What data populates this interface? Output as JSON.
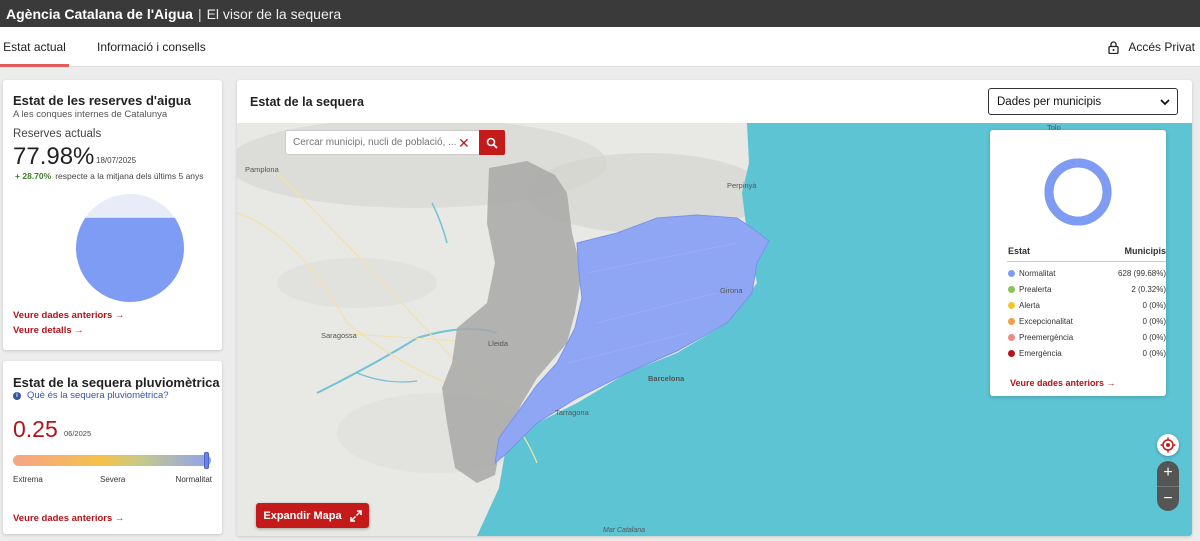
{
  "header": {
    "brand": "Agència Catalana de l'Aigua",
    "separator": "|",
    "subtitle": "El visor de la sequera"
  },
  "nav": {
    "tabs": [
      {
        "label": "Estat actual",
        "active": true
      },
      {
        "label": "Informació i consells",
        "active": false
      }
    ],
    "private_access": "Accés Privat"
  },
  "reserves": {
    "title": "Estat de les reserves d'aigua",
    "subtitle": "A les conques internes de Catalunya",
    "label": "Reserves actuals",
    "value": "77.98%",
    "fill_fraction": 0.7798,
    "date": "18/07/2025",
    "delta_prefix": "+",
    "delta": "28.70%",
    "delta_text": "respecte a la mitjana dels últims 5 anys",
    "link_previous": "Veure dades anteriors",
    "link_details": "Veure detalls"
  },
  "pluviometric": {
    "title": "Estat de la sequera pluviomètrica",
    "info_link": "Què és la sequera pluviomètrica?",
    "value": "0.25",
    "date": "06/2025",
    "scale_labels": [
      "Extrema",
      "Severa",
      "Normalitat"
    ],
    "marker_fraction": 0.985,
    "link_previous": "Veure dades anteriors"
  },
  "map": {
    "title": "Estat de la sequera",
    "select_value": "Dades per municipis",
    "search_placeholder": "Cercar municipi, nucli de població, ...",
    "expand_label": "Expandir Mapa",
    "place_labels": {
      "pamplona": "Pamplona",
      "perpinya": "Perpinyà",
      "saragossa": "Saragossa",
      "lleida": "Lleida",
      "girona": "Girona",
      "barcelona": "Barcelona",
      "tarragona": "Tarragona",
      "mar": "Mar Catalana",
      "tolo": "Tolo"
    },
    "zoom_in": "+",
    "zoom_out": "−"
  },
  "legend": {
    "col_state": "Estat",
    "col_count": "Municipis",
    "rows": [
      {
        "name": "Normalitat",
        "count": "628 (99.68%)",
        "color": "#7f9cf5"
      },
      {
        "name": "Prealerta",
        "count": "2 (0.32%)",
        "color": "#8cc05a"
      },
      {
        "name": "Alerta",
        "count": "0 (0%)",
        "color": "#f4c430"
      },
      {
        "name": "Excepcionalitat",
        "count": "0 (0%)",
        "color": "#f39c4a"
      },
      {
        "name": "Preemergència",
        "count": "0 (0%)",
        "color": "#ee8a8a"
      },
      {
        "name": "Emergència",
        "count": "0 (0%)",
        "color": "#b3131b"
      }
    ],
    "donut_fraction": 0.9968,
    "link_previous": "Veure dades anteriors"
  }
}
